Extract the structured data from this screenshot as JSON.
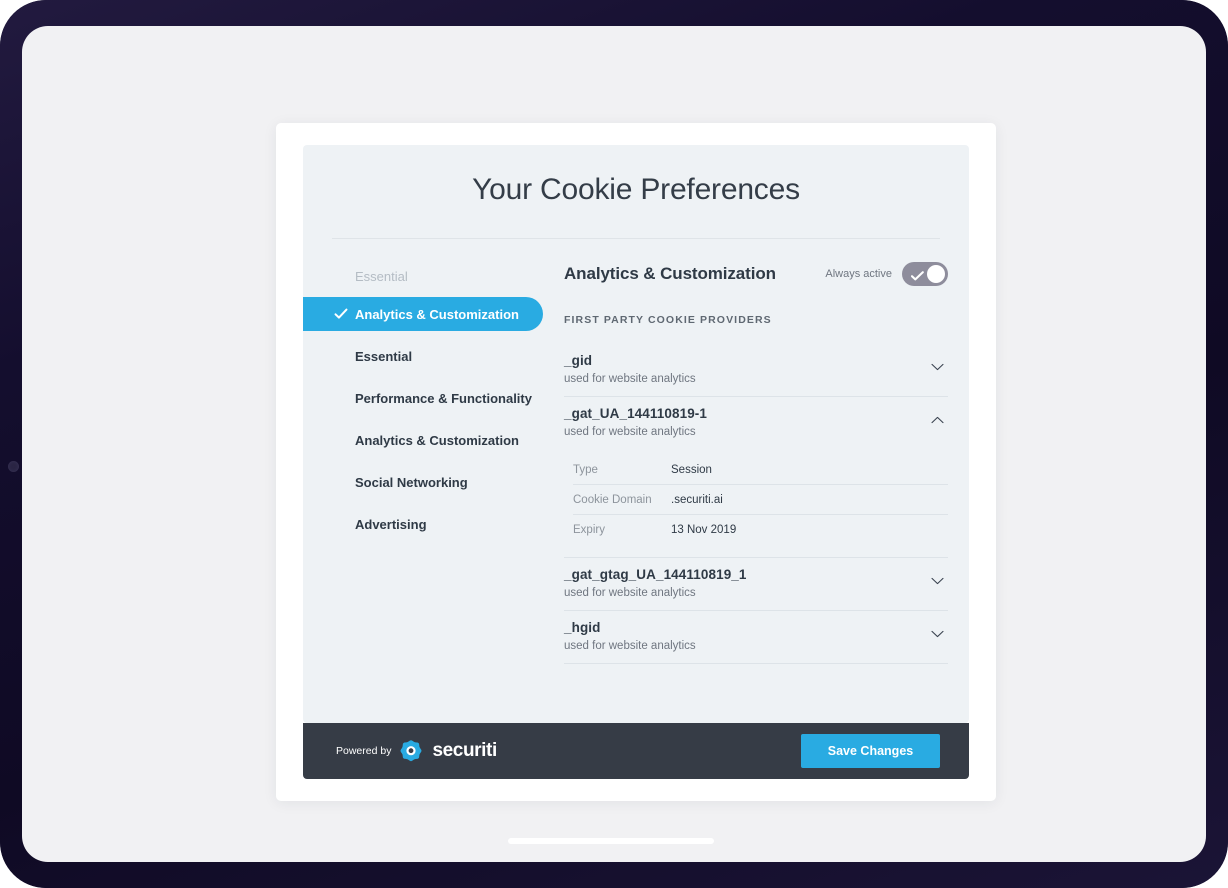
{
  "device": {
    "frame_color": "#140e2e",
    "screen_bg": "#f1f1f3"
  },
  "panel": {
    "title": "Your Cookie Preferences",
    "bg_color": "#eef2f5",
    "accent_color": "#29abe2"
  },
  "sidebar": {
    "section_label": "Essential",
    "active_index": 0,
    "items": [
      {
        "label": "Analytics & Customization",
        "active": true
      },
      {
        "label": "Essential",
        "active": false
      },
      {
        "label": "Performance & Functionality",
        "active": false
      },
      {
        "label": "Analytics & Customization",
        "active": false
      },
      {
        "label": "Social Networking",
        "active": false
      },
      {
        "label": "Advertising",
        "active": false
      }
    ]
  },
  "content": {
    "title": "Analytics & Customization",
    "toggle": {
      "label": "Always active",
      "state": "on",
      "track_color": "#8e8d9c"
    },
    "providers_label": "FIRST PARTY COOKIE PROVIDERS",
    "cookies": [
      {
        "name": "_gid",
        "description": "used for website analytics",
        "expanded": false,
        "details": []
      },
      {
        "name": "_gat_UA_144110819-1",
        "description": "used for website analytics",
        "expanded": true,
        "details": [
          {
            "key": "Type",
            "value": "Session"
          },
          {
            "key": "Cookie Domain",
            "value": ".securiti.ai"
          },
          {
            "key": "Expiry",
            "value": "13 Nov 2019"
          }
        ]
      },
      {
        "name": "_gat_gtag_UA_144110819_1",
        "description": "used for website analytics",
        "expanded": false,
        "details": []
      },
      {
        "name": "_hgid",
        "description": "used for website analytics",
        "expanded": false,
        "details": []
      }
    ]
  },
  "footer": {
    "powered_by": "Powered by",
    "brand": "securiti",
    "brand_logo": "securiti-logo-icon",
    "save_label": "Save Changes",
    "bg_color": "#363c46",
    "button_color": "#29abe2"
  }
}
